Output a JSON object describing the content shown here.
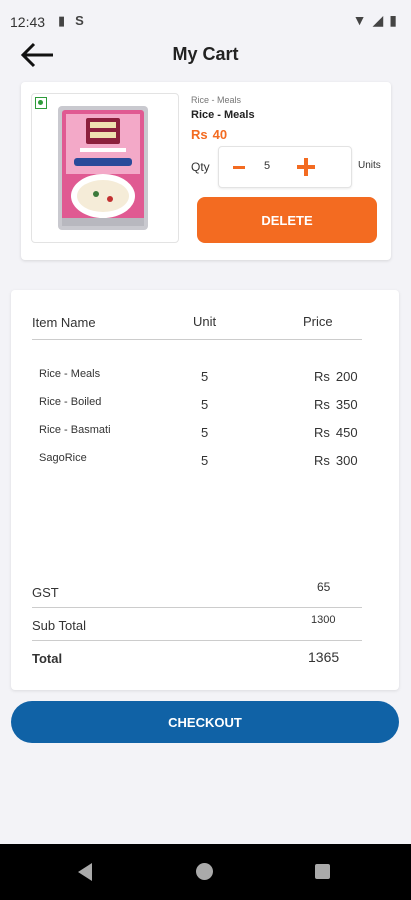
{
  "status_bar": {
    "time": "12:43",
    "left_icons": [
      "sd-card-icon",
      "sim-icon"
    ],
    "right_icons": [
      "wifi-icon",
      "signal-icon",
      "battery-icon"
    ]
  },
  "header": {
    "title": "My Cart",
    "back_icon": "arrow-left-icon"
  },
  "cart_item": {
    "category": "Rice - Meals",
    "name": "Rice - Meals",
    "currency": "Rs",
    "price": "40",
    "qty_label": "Qty",
    "quantity": "5",
    "units_label": "Units",
    "delete_label": "DELETE",
    "veg_badge": true,
    "image_icon": "rice-bag-image"
  },
  "summary": {
    "headers": {
      "name": "Item Name",
      "unit": "Unit",
      "price": "Price"
    },
    "rows": [
      {
        "name": "Rice - Meals",
        "unit": "5",
        "currency": "Rs",
        "price": "200"
      },
      {
        "name": "Rice - Boiled",
        "unit": "5",
        "currency": "Rs",
        "price": "350"
      },
      {
        "name": "Rice - Basmati",
        "unit": "5",
        "currency": "Rs",
        "price": "450"
      },
      {
        "name": "SagoRice",
        "unit": "5",
        "currency": "Rs",
        "price": "300"
      }
    ],
    "gst_label": "GST",
    "gst_value": "65",
    "subtotal_label": "Sub Total",
    "subtotal_value": "1300",
    "total_label": "Total",
    "total_value": "1365"
  },
  "checkout_label": "CHECKOUT",
  "colors": {
    "accent_orange": "#f36b21",
    "checkout_blue": "#1062a6",
    "background": "#f3f3f7"
  },
  "nav_bar": {
    "icons": [
      "nav-back-icon",
      "nav-home-icon",
      "nav-recents-icon"
    ]
  }
}
